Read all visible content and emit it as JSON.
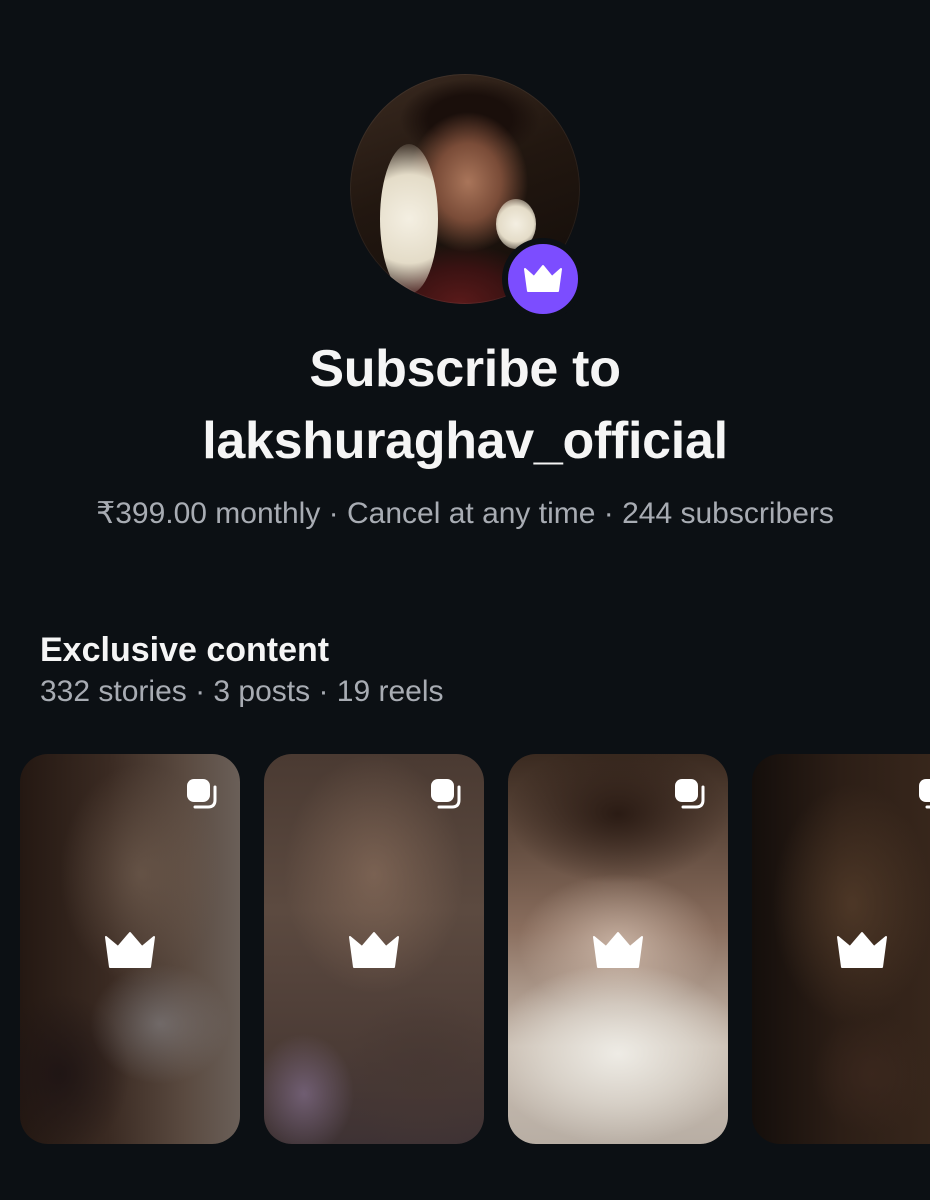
{
  "profile": {
    "avatar_alt": "lakshuraghav_official",
    "badge_icon": "crown-icon",
    "badge_color": "#7c4dff"
  },
  "header": {
    "title_line1": "Subscribe to",
    "title_line2": "lakshuraghav_official"
  },
  "subscription": {
    "meta": "₹399.00 monthly · Cancel at any time · 244 subscribers"
  },
  "exclusive": {
    "title": "Exclusive content",
    "summary": "332 stories · 3 posts · 19 reels"
  },
  "cards": [
    {
      "type": "locked",
      "corner_icon": "multiple-posts-icon",
      "center_icon": "crown-icon"
    },
    {
      "type": "locked",
      "corner_icon": "multiple-posts-icon",
      "center_icon": "crown-icon"
    },
    {
      "type": "locked",
      "corner_icon": "multiple-posts-icon",
      "center_icon": "crown-icon"
    },
    {
      "type": "locked",
      "corner_icon": "multiple-posts-icon",
      "center_icon": "crown-icon"
    }
  ],
  "colors": {
    "background": "#0c1014",
    "text_primary": "#f5f5f5",
    "text_secondary": "#a8acb3",
    "accent": "#7c4dff"
  }
}
